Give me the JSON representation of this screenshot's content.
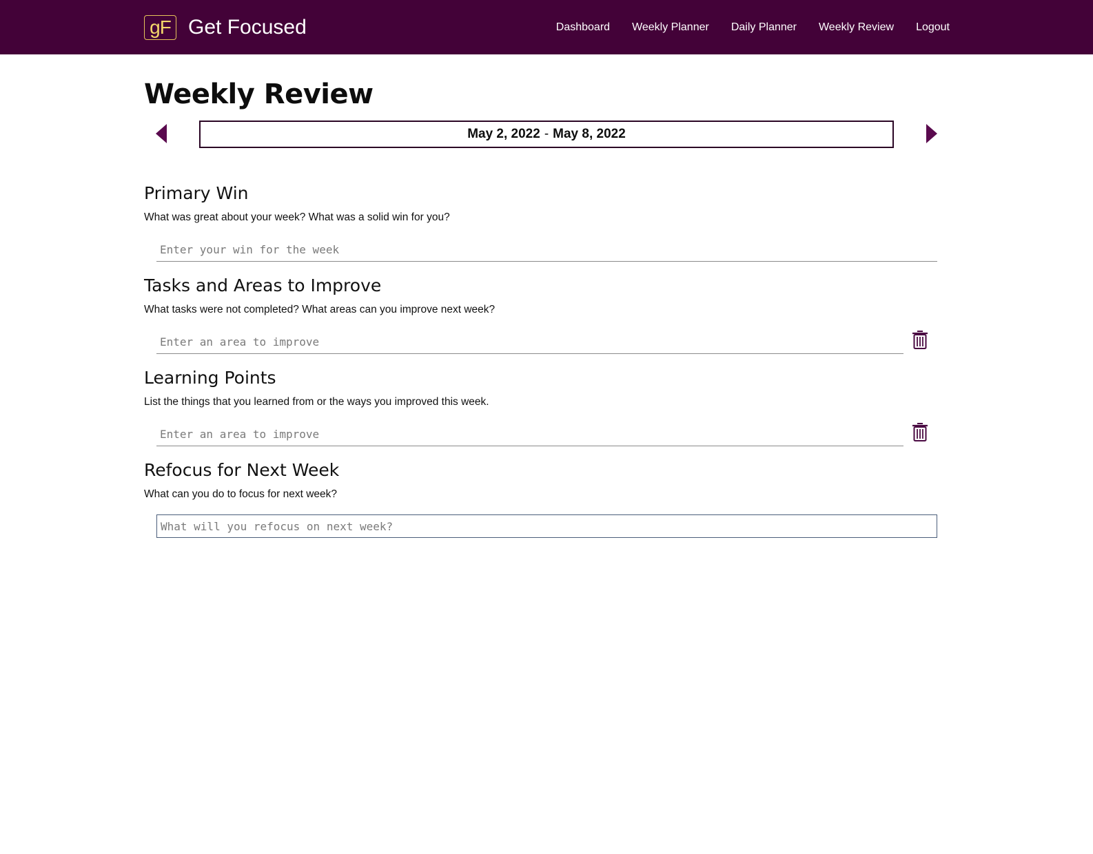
{
  "brand": {
    "logo_text": "gF",
    "name": "Get Focused"
  },
  "nav": {
    "items": [
      {
        "label": "Dashboard"
      },
      {
        "label": "Weekly Planner"
      },
      {
        "label": "Daily Planner"
      },
      {
        "label": "Weekly Review"
      },
      {
        "label": "Logout"
      }
    ]
  },
  "page": {
    "title": "Weekly Review"
  },
  "week": {
    "start": "May 2, 2022",
    "separator": "-",
    "end": "May 8, 2022"
  },
  "sections": {
    "primary_win": {
      "title": "Primary Win",
      "description": "What was great about your week? What was a solid win for you?",
      "placeholder": "Enter your win for the week",
      "value": ""
    },
    "improve": {
      "title": "Tasks and Areas to Improve",
      "description": "What tasks were not completed? What areas can you improve next week?",
      "placeholder": "Enter an area to improve",
      "value": ""
    },
    "learning": {
      "title": "Learning Points",
      "description": "List the things that you learned from or the ways you improved this week.",
      "placeholder": "Enter an area to improve",
      "value": ""
    },
    "refocus": {
      "title": "Refocus for Next Week",
      "description": "What can you do to focus for next week?",
      "placeholder": "What will you refocus on next week?",
      "value": ""
    }
  },
  "icons": {
    "prev": "caret-left-icon",
    "next": "caret-right-icon",
    "delete": "trash-icon"
  },
  "colors": {
    "navbar_bg": "#430238",
    "accent": "#5a0a4e",
    "logo_gold": "#f4d86a"
  }
}
